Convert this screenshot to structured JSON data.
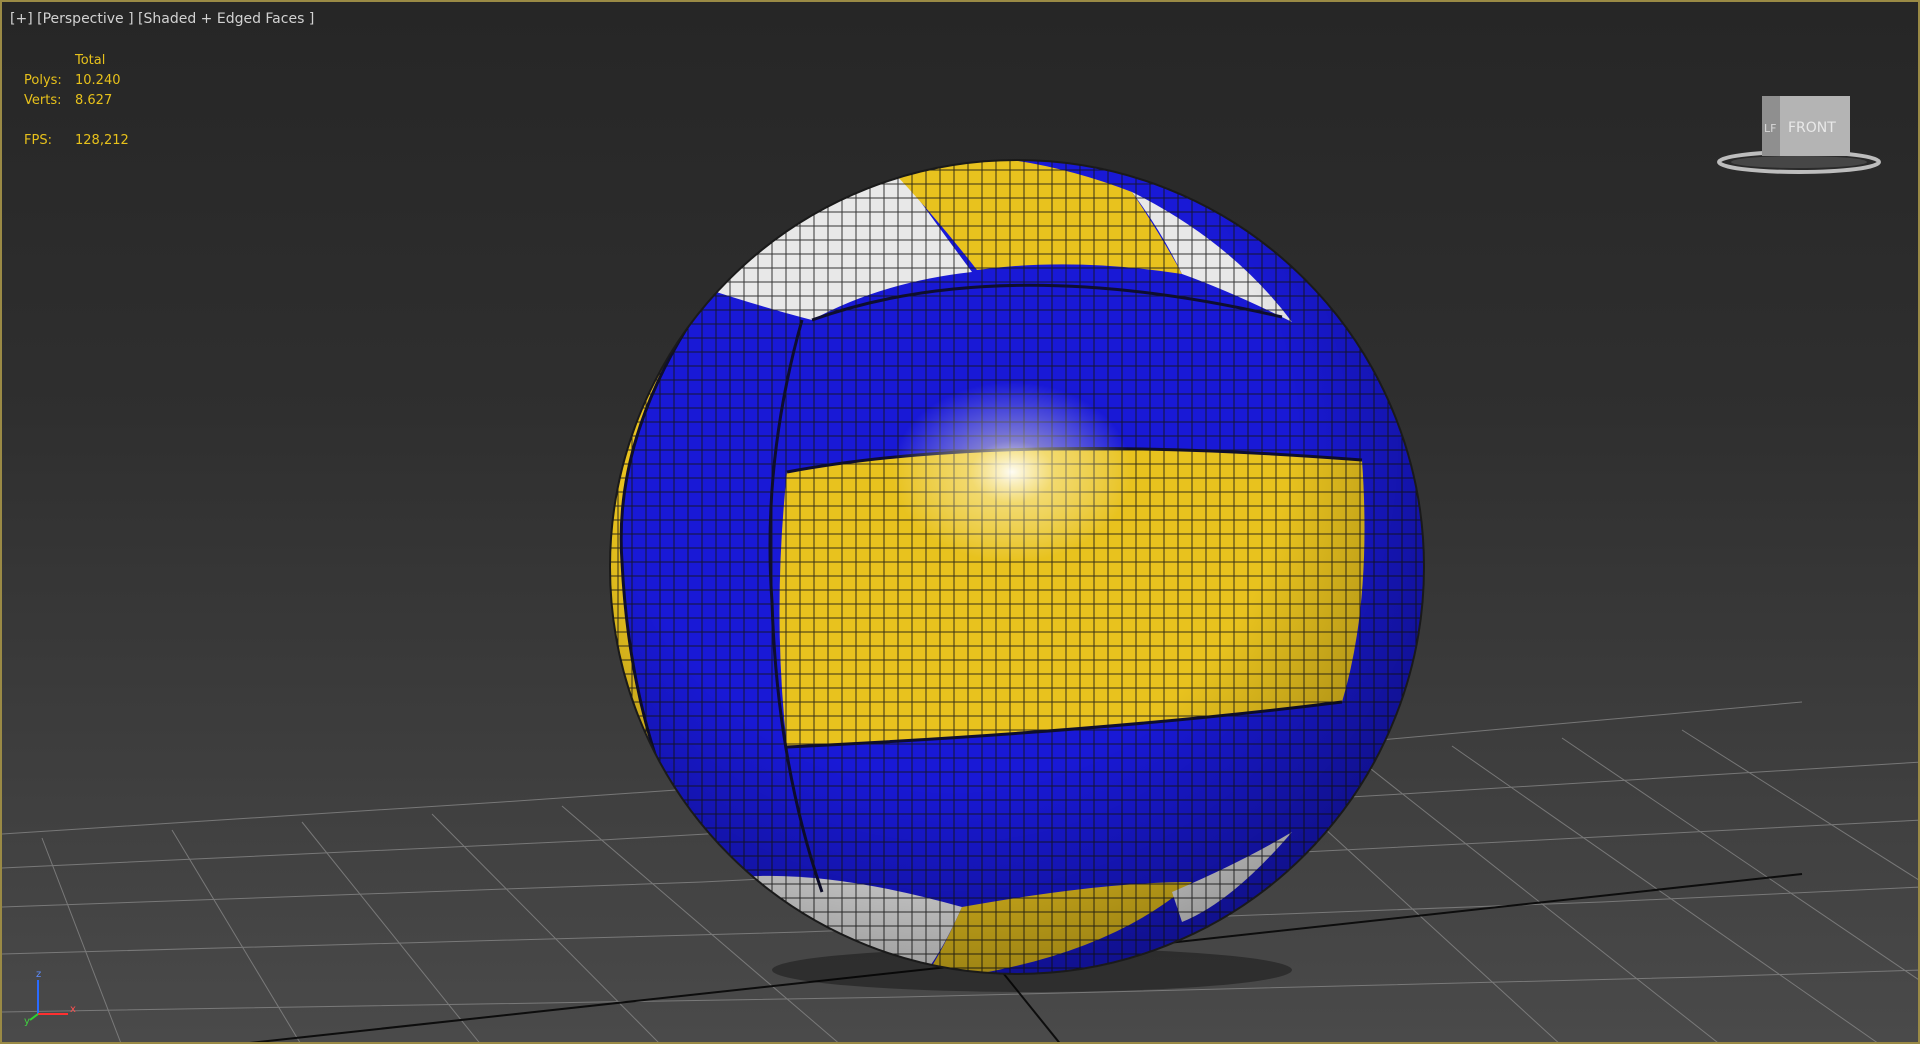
{
  "viewport": {
    "menu_plus": "[+]",
    "view_name": "[Perspective ]",
    "shading_mode": "[Shaded + Edged Faces ]"
  },
  "stats": {
    "header": "Total",
    "polys_label": "Polys:",
    "polys_value": "10.240",
    "verts_label": "Verts:",
    "verts_value": "8.627",
    "fps_label": "FPS:",
    "fps_value": "128,212"
  },
  "viewcube": {
    "face_label": "FRONT",
    "side_label": "LF"
  },
  "axis_gizmo": {
    "z_label": "z",
    "x_label": "x",
    "y_label": "y"
  },
  "colors": {
    "border": "#9a8a45",
    "stats_text": "#e7c11b",
    "ball_blue": "#1919d6",
    "ball_yellow": "#e8c21e",
    "ball_white": "#e8e8e8",
    "grid_line": "#8a8a8a"
  }
}
